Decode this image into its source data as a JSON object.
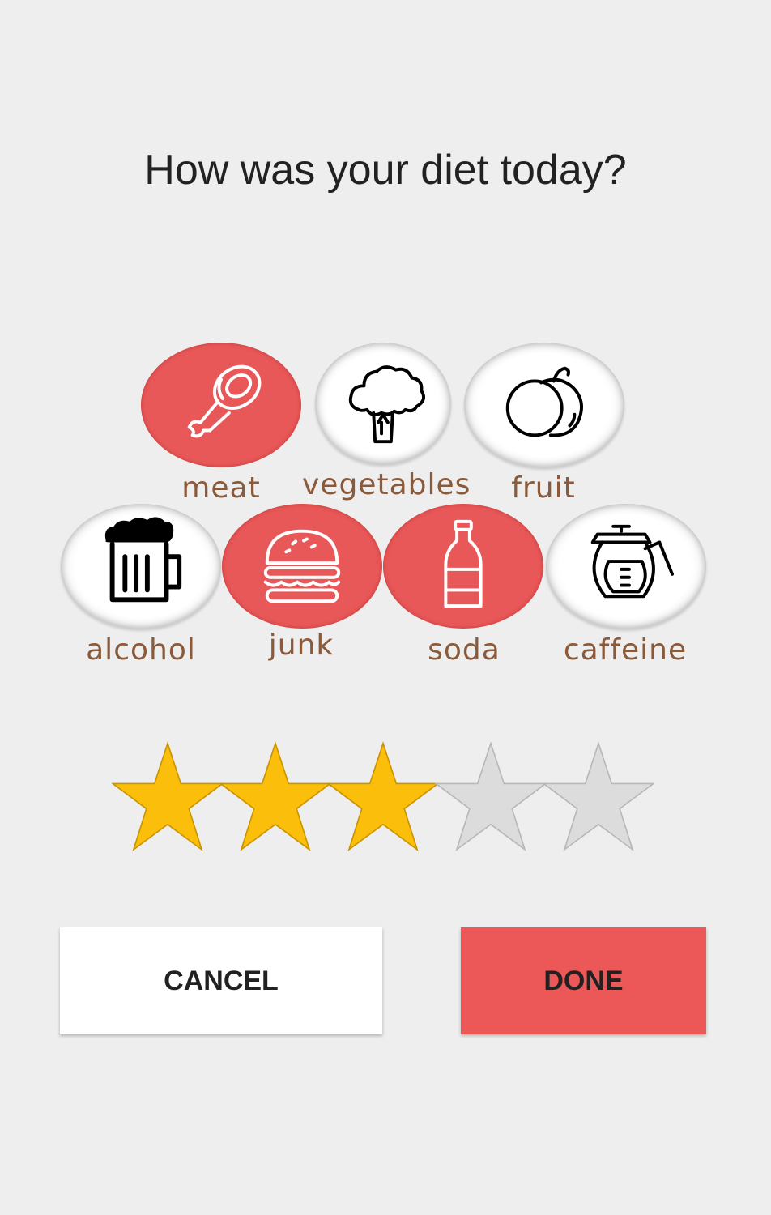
{
  "title": "How was your diet today?",
  "foods": [
    {
      "label": "meat",
      "selected": true,
      "icon": "ham-leg-icon"
    },
    {
      "label": "vegetables",
      "selected": false,
      "icon": "broccoli-icon"
    },
    {
      "label": "fruit",
      "selected": false,
      "icon": "peach-icon"
    },
    {
      "label": "alcohol",
      "selected": false,
      "icon": "beer-mug-icon"
    },
    {
      "label": "junk",
      "selected": true,
      "icon": "burger-icon"
    },
    {
      "label": "soda",
      "selected": true,
      "icon": "bottle-icon"
    },
    {
      "label": "caffeine",
      "selected": false,
      "icon": "coffee-pot-icon"
    }
  ],
  "rating": {
    "value": 3,
    "max": 5
  },
  "colors": {
    "selected": "#e95858",
    "star_filled": "#fbbf0b",
    "star_empty": "#dcdcdc",
    "label": "#8a5a3a",
    "done_button": "#ec5757"
  },
  "buttons": {
    "cancel": "CANCEL",
    "done": "DONE"
  }
}
